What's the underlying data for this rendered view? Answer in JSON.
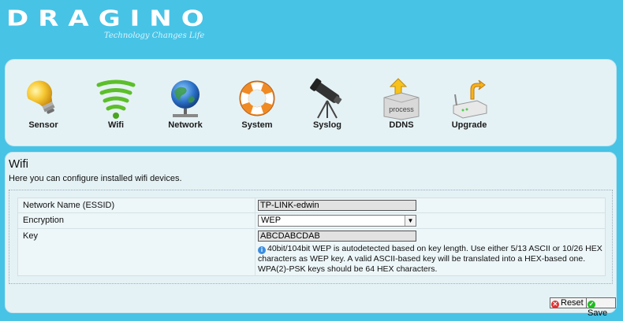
{
  "header": {
    "brand": "DRAGINO",
    "tagline": "Technology Changes Life"
  },
  "nav": {
    "items": [
      {
        "label": "Sensor",
        "icon": "lightbulb-icon"
      },
      {
        "label": "Wifi",
        "icon": "wifi-icon"
      },
      {
        "label": "Network",
        "icon": "globe-network-icon"
      },
      {
        "label": "System",
        "icon": "lifebuoy-icon"
      },
      {
        "label": "Syslog",
        "icon": "telescope-icon"
      },
      {
        "label": "DDNS",
        "icon": "process-box-icon"
      },
      {
        "label": "Upgrade",
        "icon": "router-upgrade-icon"
      }
    ]
  },
  "page": {
    "title": "Wifi",
    "description": "Here you can configure installed wifi devices."
  },
  "form": {
    "essid_label": "Network Name (ESSID)",
    "essid_value": "TP-LINK-edwin",
    "encryption_label": "Encryption",
    "encryption_value": "WEP",
    "key_label": "Key",
    "key_value": "ABCDABCDAB",
    "key_help": "40bit/104bit WEP is autodetected based on key length. Use either 5/13 ASCII or 10/26 HEX characters as WEP key. A valid ASCII-based key will be translated into a HEX-based one. WPA(2)-PSK keys should be 64 HEX characters."
  },
  "buttons": {
    "reset": "Reset",
    "save": "Save"
  },
  "colors": {
    "background": "#47c3e6",
    "panel": "#e5f2f5"
  }
}
